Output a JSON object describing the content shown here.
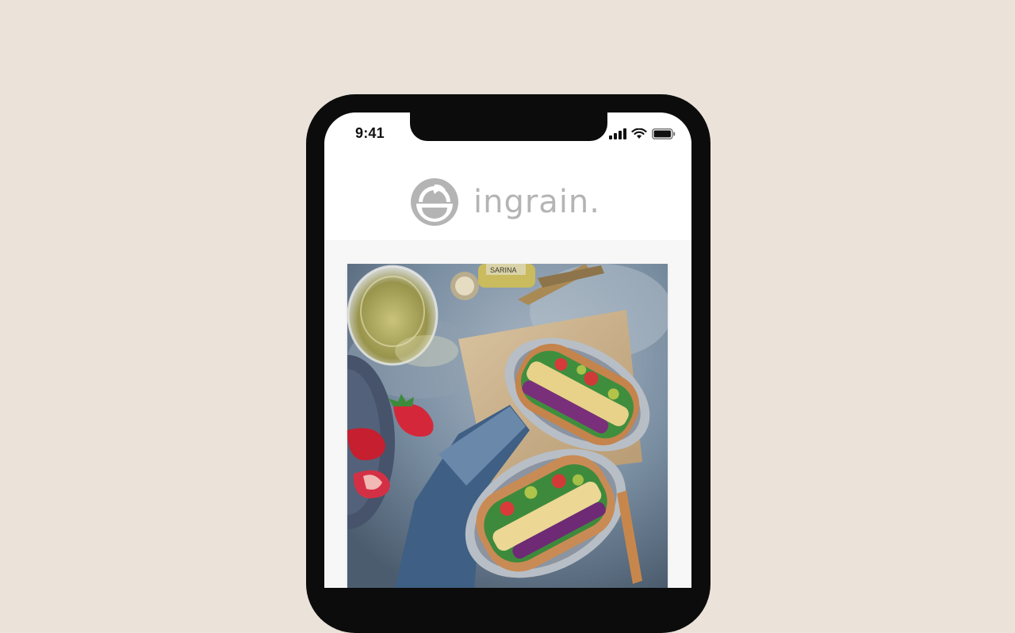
{
  "status_bar": {
    "time": "9:41",
    "icons": [
      "cellular-signal-icon",
      "wifi-icon",
      "battery-icon"
    ]
  },
  "header": {
    "logo_text": "ingrain.",
    "logo_icon": "bowl-logo-icon"
  },
  "hero": {
    "image_subject": "hero-food-photo",
    "bottle_label": "SARINA"
  },
  "colors": {
    "background": "#ebe3da",
    "device_frame": "#0c0c0c",
    "logo_gray": "#b4b4b4",
    "screen_background": "#f7f7f7"
  }
}
